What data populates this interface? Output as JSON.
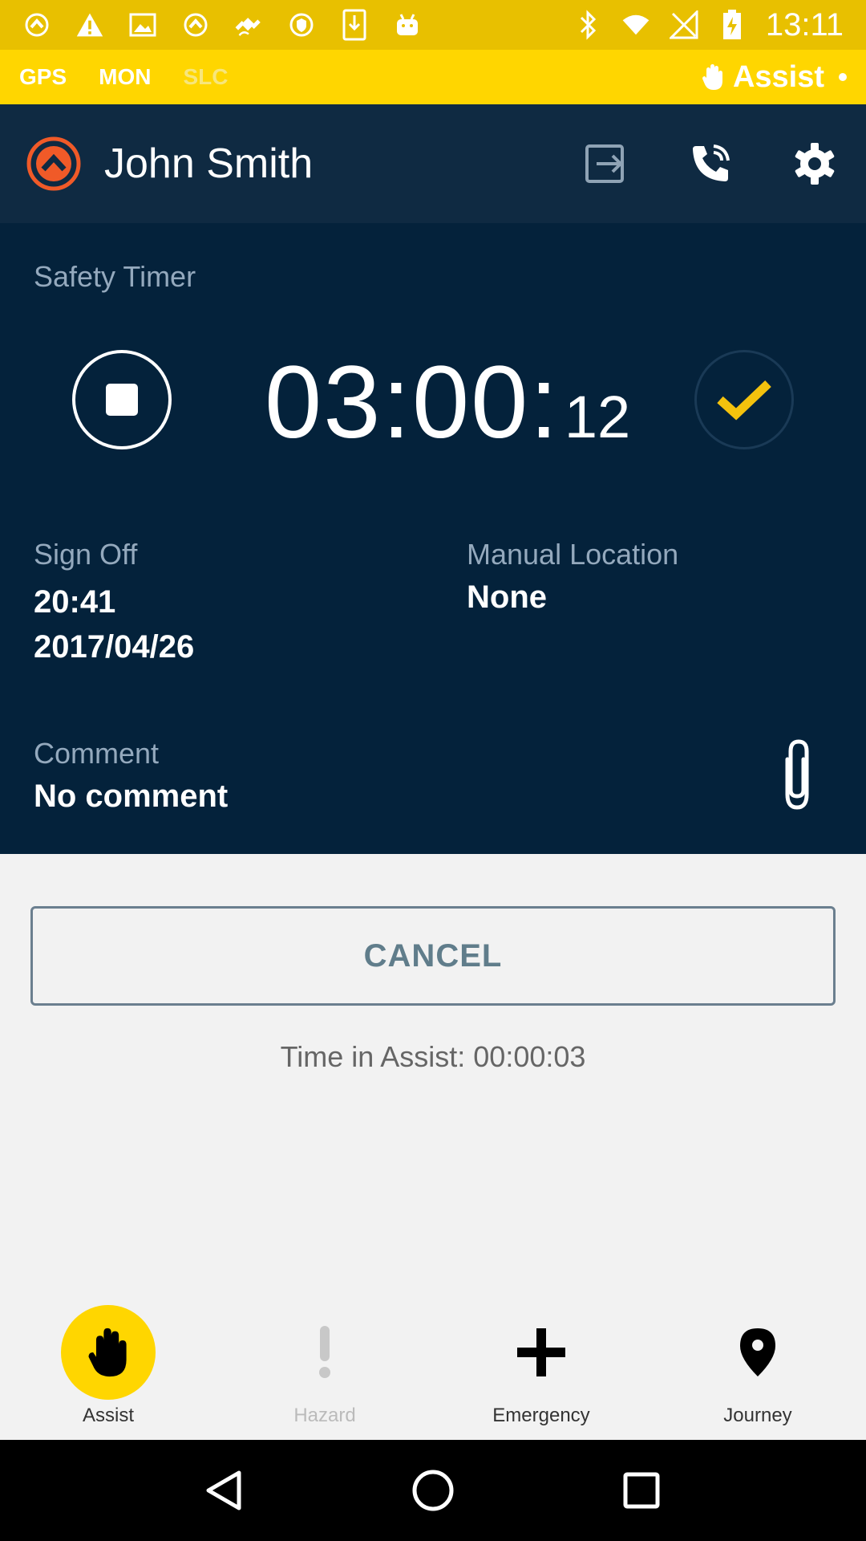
{
  "status_bar": {
    "time": "13:11",
    "icons_left": [
      "app-notification-icon",
      "warning-icon",
      "image-icon",
      "app-notification-icon",
      "fake-gps-icon",
      "shield-icon",
      "download-icon",
      "android-icon"
    ],
    "icons_right": [
      "bluetooth-icon",
      "wifi-icon",
      "no-signal-icon",
      "battery-charging-icon"
    ]
  },
  "mode_bar": {
    "modes": [
      {
        "label": "GPS",
        "active": true
      },
      {
        "label": "MON",
        "active": true
      },
      {
        "label": "SLC",
        "active": false
      }
    ],
    "assist_label": "Assist"
  },
  "header": {
    "user_name": "John Smith",
    "actions": [
      "logout-icon",
      "phone-icon",
      "settings-icon"
    ]
  },
  "timer": {
    "title": "Safety Timer",
    "main": "03:00:",
    "seconds": "12"
  },
  "sign_off": {
    "label": "Sign Off",
    "time": "20:41",
    "date": "2017/04/26"
  },
  "manual_location": {
    "label": "Manual Location",
    "value": "None"
  },
  "comment": {
    "label": "Comment",
    "value": "No comment"
  },
  "cancel_label": "CANCEL",
  "time_in_assist": "Time in Assist: 00:00:03",
  "bottom_nav": [
    {
      "label": "Assist",
      "icon": "hand-icon",
      "active": true
    },
    {
      "label": "Hazard",
      "icon": "exclamation-icon",
      "active": false
    },
    {
      "label": "Emergency",
      "icon": "plus-icon",
      "active": false
    },
    {
      "label": "Journey",
      "icon": "location-pin-icon",
      "active": false
    }
  ],
  "colors": {
    "accent": "#ffd600",
    "status_bar": "#e8c000",
    "header_bg": "#0f2a42",
    "panel_bg": "#04223b",
    "logo": "#f05a28"
  }
}
